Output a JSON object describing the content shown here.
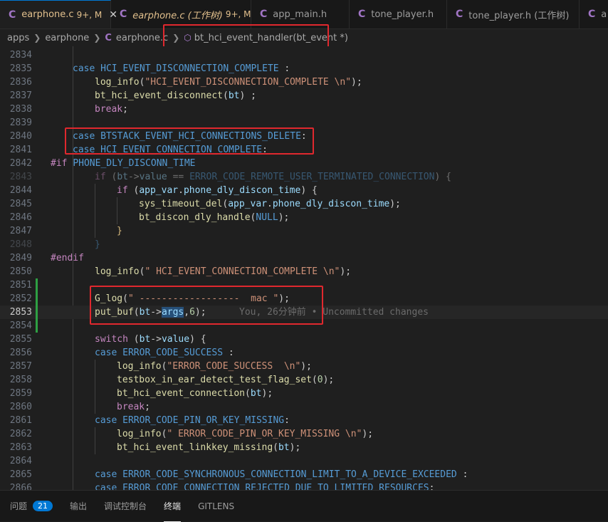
{
  "tabs": [
    {
      "title": "earphone.c",
      "status": "9+, M",
      "active": true,
      "italic": false,
      "closable": true
    },
    {
      "title": "earphone.c (工作树)",
      "status": "9+, M",
      "active": false,
      "italic": true,
      "closable": false
    },
    {
      "title": "app_main.h",
      "status": "",
      "active": false,
      "italic": false,
      "closable": false
    },
    {
      "title": "tone_player.h",
      "status": "",
      "active": false,
      "italic": false,
      "closable": false
    },
    {
      "title": "tone_player.h (工作树)",
      "status": "",
      "active": false,
      "italic": false,
      "closable": false
    },
    {
      "title": "a",
      "status": "",
      "active": false,
      "italic": false,
      "closable": false
    }
  ],
  "breadcrumb": {
    "seg1": "apps",
    "seg2": "earphone",
    "seg3": "earphone.c",
    "seg4": "bt_hci_event_handler(bt_event *)"
  },
  "editor": {
    "line_numbers": [
      "2834",
      "2835",
      "2836",
      "2837",
      "2838",
      "2839",
      "2840",
      "2841",
      "2842",
      "2843",
      "2844",
      "2845",
      "2846",
      "2847",
      "2848",
      "2849",
      "2850",
      "2851",
      "2852",
      "2853",
      "2854",
      "2855",
      "2856",
      "2857",
      "2858",
      "2859",
      "2860",
      "2861",
      "2862",
      "2863",
      "2864",
      "2865",
      "2866"
    ],
    "current_line": "2853",
    "blame": "You, 26分钟前 • Uncommitted changes",
    "tokens": {
      "case": "case",
      "break": "break",
      "if": "if",
      "switch": "switch",
      "pp_if": "#if",
      "pp_endif": "#endif",
      "disc_complete": "HCI_EVENT_DISCONNECTION_COMPLETE",
      "log_info": "log_info",
      "s_disc": "\"HCI_EVENT_DISCONNECTION_COMPLETE \\n\"",
      "bt_disc": "bt_hci_event_disconnect",
      "bt": "bt",
      "conn_delete": "BTSTACK_EVENT_HCI_CONNECTIONS_DELETE",
      "conn_complete": "HCI_EVENT_CONNECTION_COMPLETE",
      "phone_dly": "PHONE_DLY_DISCONN_TIME",
      "value": "value",
      "err_remote": "ERROR_CODE_REMOTE_USER_TERMINATED_CONNECTION",
      "app_var": "app_var",
      "phone_dly_time": "phone_dly_discon_time",
      "sys_timeout_del": "sys_timeout_del",
      "bt_discon_handle": "bt_discon_dly_handle",
      "null": "NULL",
      "s_conn_complete": "\" HCI_EVENT_CONNECTION_COMPLETE \\n\"",
      "g_log": "G_log",
      "s_mac": "\" ------------------  mac \"",
      "put_buf": "put_buf",
      "args": "args",
      "six": "6",
      "err_success": "ERROR_CODE_SUCCESS",
      "s_success": "\"ERROR_CODE_SUCCESS  \\n\"",
      "testbox": "testbox_in_ear_detect_test_flag_set",
      "zero": "0",
      "bt_conn": "bt_hci_event_connection",
      "err_pin": "ERROR_CODE_PIN_OR_KEY_MISSING",
      "s_pin": "\" ERROR_CODE_PIN_OR_KEY_MISSING \\n\"",
      "bt_linkkey": "bt_hci_event_linkkey_missing",
      "err_sync": "ERROR_CODE_SYNCHRONOUS_CONNECTION_LIMIT_TO_A_DEVICE_EXCEEDED",
      "err_rejected": "ERROR_CODE_CONNECTION_REJECTED_DUE_TO_LIMITED_RESOURCES"
    }
  },
  "panel": {
    "problems": "问题",
    "problems_count": "21",
    "output": "输出",
    "debug_console": "调试控制台",
    "terminal": "终端",
    "gitlens": "GITLENS"
  },
  "colors": {
    "accent": "#0078d4",
    "highlight_box": "#e0282e",
    "modified_gutter": "#2ea043"
  }
}
